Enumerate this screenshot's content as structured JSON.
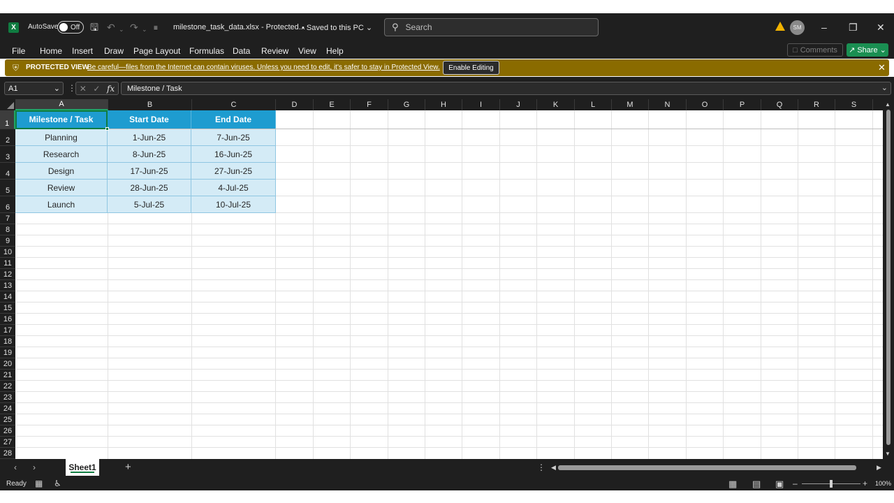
{
  "titlebar": {
    "app_icon": "excel-icon",
    "autosave_label": "AutoSave",
    "autosave_state": "Off",
    "filename": "milestone_task_data.xlsx  -  Protected...",
    "saved_status": "•  Saved to this PC",
    "search_placeholder": "Search",
    "user_initials": "SM"
  },
  "menu": {
    "items": [
      "File",
      "Home",
      "Insert",
      "Draw",
      "Page Layout",
      "Formulas",
      "Data",
      "Review",
      "View",
      "Help"
    ],
    "comments_label": "Comments",
    "share_label": "Share"
  },
  "protected_view": {
    "title": "PROTECTED VIEW",
    "message": "Be careful—files from the Internet can contain viruses. Unless you need to edit, it's safer to stay in Protected View.",
    "enable_button": "Enable Editing"
  },
  "formula_bar": {
    "name_box": "A1",
    "fx_label": "fx",
    "content": "Milestone / Task"
  },
  "columns": [
    "A",
    "B",
    "C",
    "D",
    "E",
    "F",
    "G",
    "H",
    "I",
    "J",
    "K",
    "L",
    "M",
    "N",
    "O",
    "P",
    "Q",
    "R",
    "S"
  ],
  "rows": [
    "1",
    "2",
    "3",
    "4",
    "5",
    "6",
    "7",
    "8",
    "9",
    "10",
    "11",
    "12",
    "13",
    "14",
    "15",
    "16",
    "17",
    "18",
    "19",
    "20",
    "21",
    "22",
    "23",
    "24",
    "25",
    "26",
    "27",
    "28"
  ],
  "table": {
    "headers": [
      "Milestone / Task",
      "Start Date",
      "End Date"
    ],
    "rows": [
      [
        "Planning",
        "1-Jun-25",
        "7-Jun-25"
      ],
      [
        "Research",
        "8-Jun-25",
        "16-Jun-25"
      ],
      [
        "Design",
        "17-Jun-25",
        "27-Jun-25"
      ],
      [
        "Review",
        "28-Jun-25",
        "4-Jul-25"
      ],
      [
        "Launch",
        "5-Jul-25",
        "10-Jul-25"
      ]
    ]
  },
  "sheet_tabs": {
    "active": "Sheet1"
  },
  "status_bar": {
    "ready": "Ready",
    "zoom": "100%"
  },
  "colors": {
    "header_fill": "#1e9cd0",
    "data_fill": "#d4ebf6",
    "accent_green": "#107c41",
    "protected_bar": "#8a6b00"
  }
}
